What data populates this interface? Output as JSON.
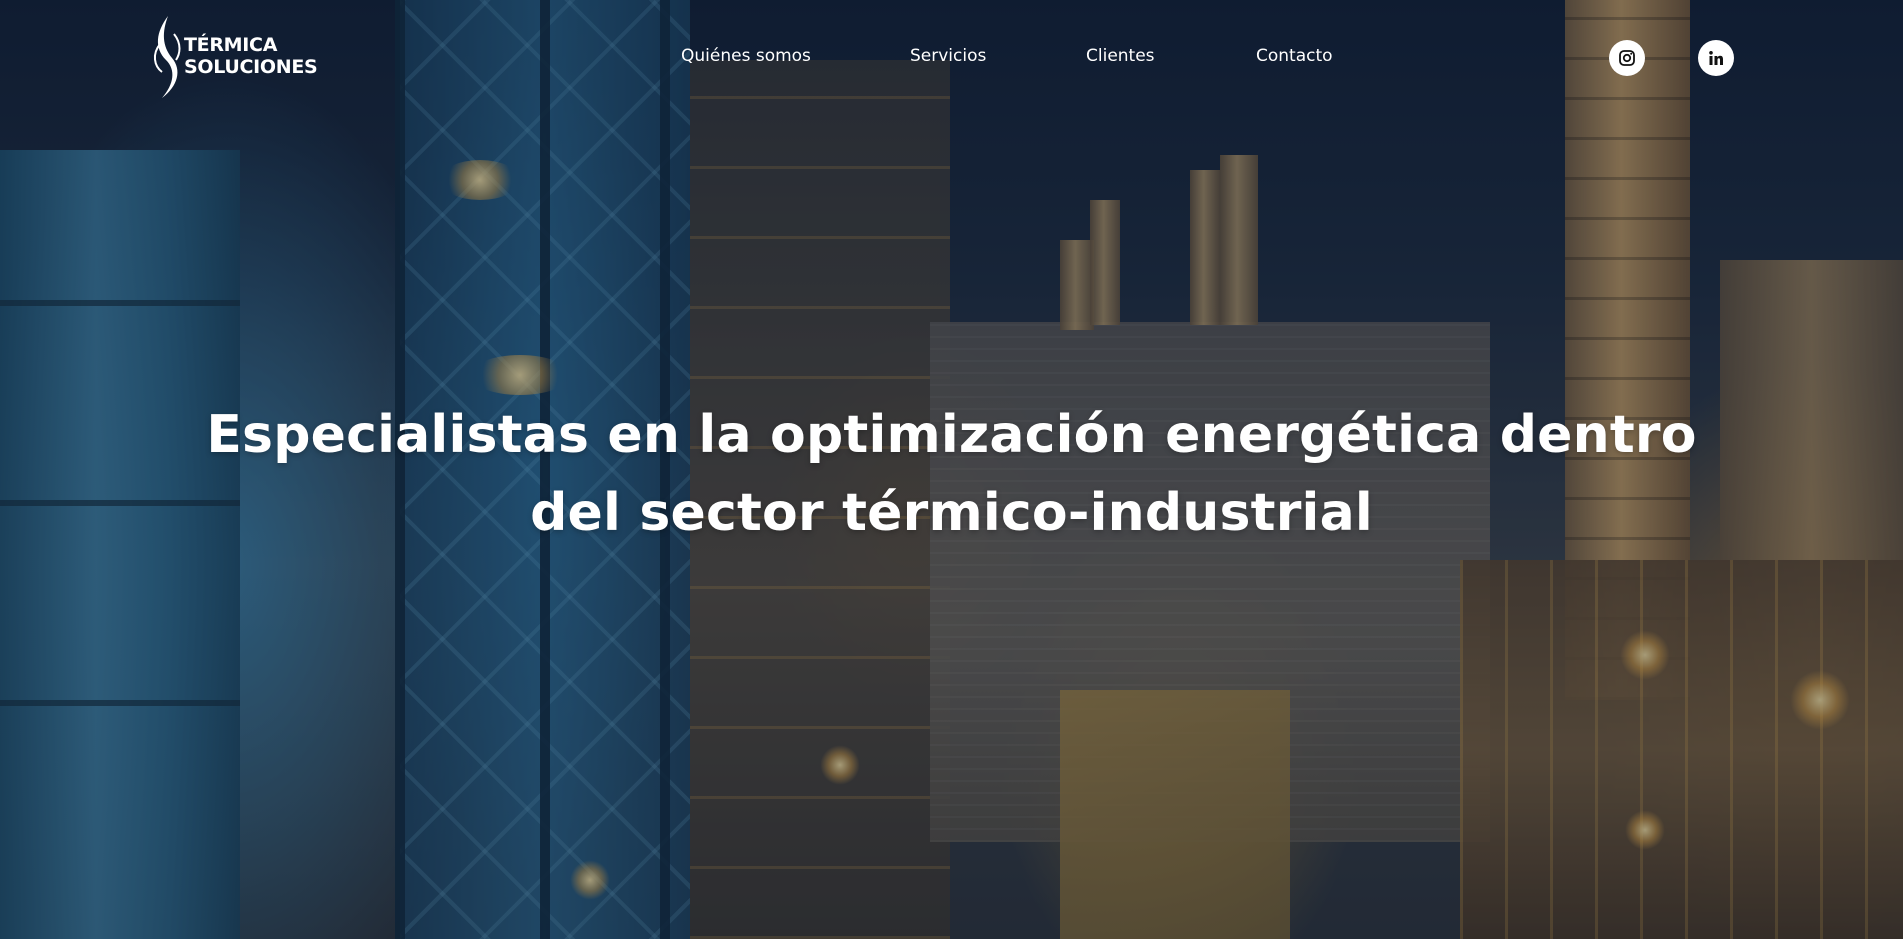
{
  "brand": {
    "name_line1": "TÉRMICA",
    "name_line2": "SOLUCIONES"
  },
  "nav": {
    "items": [
      {
        "label": "Quiénes somos"
      },
      {
        "label": "Servicios"
      },
      {
        "label": "Clientes"
      },
      {
        "label": "Contacto"
      }
    ]
  },
  "social": {
    "icons": [
      "instagram-icon",
      "linkedin-icon"
    ]
  },
  "hero": {
    "headline_line1": "Especialistas en la optimización energética dentro",
    "headline_line2": "del sector térmico-industrial"
  },
  "colors": {
    "text": "#ffffff",
    "icon_bg": "#ffffff",
    "icon_fg": "#111111"
  }
}
